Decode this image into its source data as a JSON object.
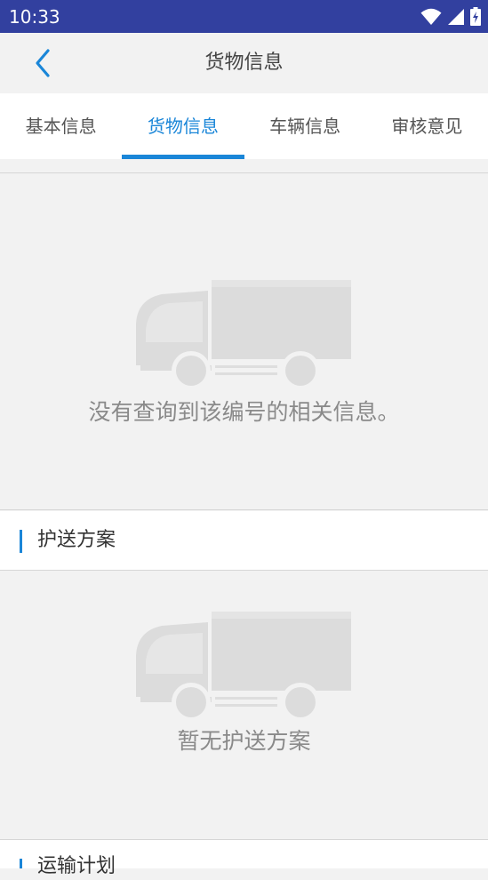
{
  "status_bar": {
    "time": "10:33",
    "icons": [
      "wifi-icon",
      "signal-icon",
      "battery-charging-icon"
    ]
  },
  "app_bar": {
    "title": "货物信息",
    "back_icon": "back-arrow-icon"
  },
  "tabs": [
    {
      "label": "基本信息",
      "active": false
    },
    {
      "label": "货物信息",
      "active": true
    },
    {
      "label": "车辆信息",
      "active": false
    },
    {
      "label": "审核意见",
      "active": false
    }
  ],
  "cargo_empty": {
    "illustration": "truck-illustration",
    "message": "没有查询到该编号的相关信息。"
  },
  "escort_section": {
    "title": "护送方案",
    "empty_message": "暂无护送方案",
    "illustration": "truck-illustration"
  },
  "transport_section": {
    "title": "运输计划"
  },
  "colors": {
    "status_bar": "#32409f",
    "accent": "#1a86d8",
    "background": "#f2f2f2",
    "empty_text": "#8a8a8a"
  }
}
